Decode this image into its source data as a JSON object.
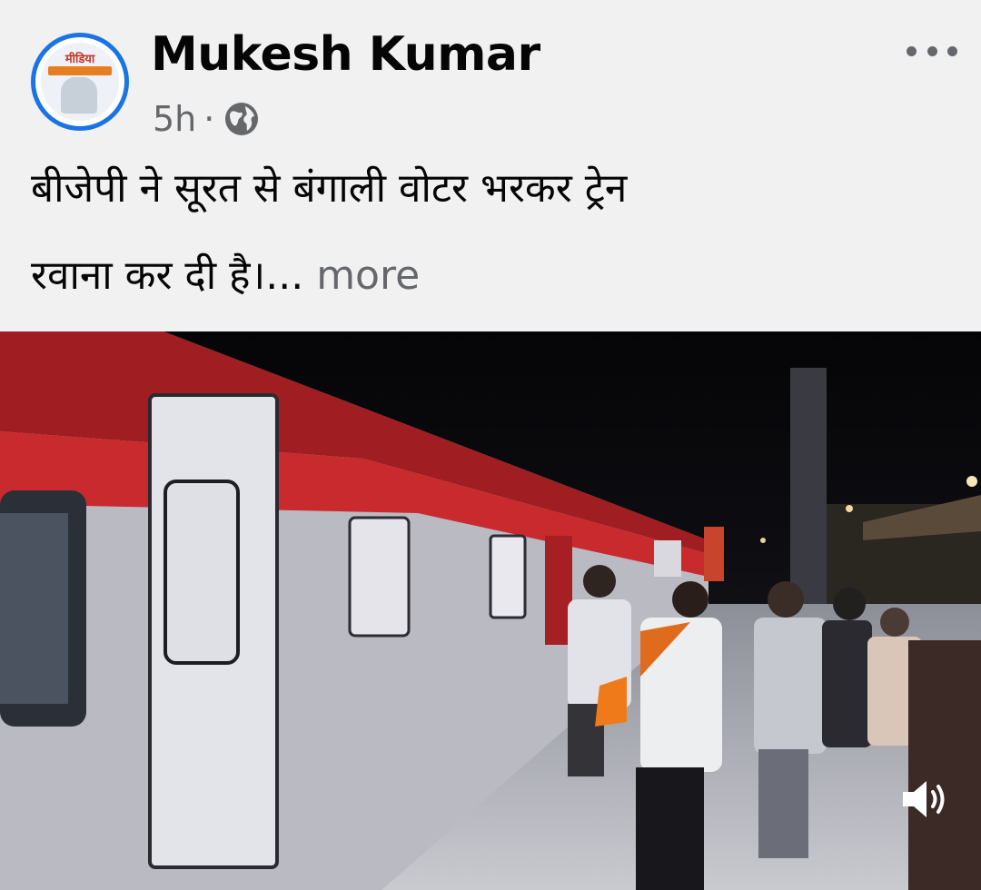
{
  "post": {
    "author_name": "Mukesh Kumar",
    "timestamp": "5h",
    "separator": "·",
    "privacy_icon": "globe-icon",
    "options_icon": "more-horizontal-icon",
    "text_line1": "बीजेपी ने सूरत से बंगाली वोटर भरकर ट्रेन",
    "text_line2": "रवाना कर दी है।...",
    "more_label": "more",
    "avatar_text": "मीडिया"
  },
  "media": {
    "type": "video",
    "sound_icon": "volume-icon"
  },
  "colors": {
    "accent": "#1b74e4",
    "text": "#050505",
    "secondary_text": "#65676b",
    "background": "#f1f1f1"
  }
}
